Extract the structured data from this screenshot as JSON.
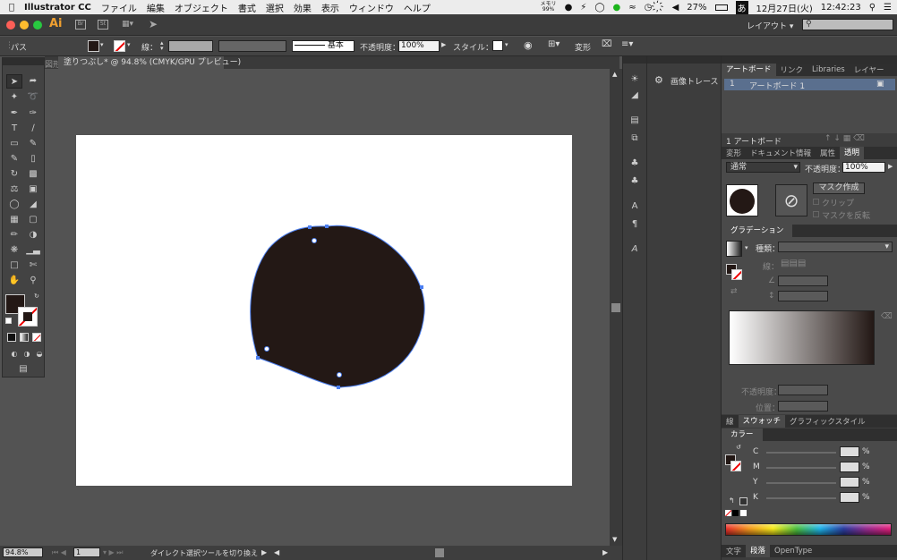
{
  "menubar": {
    "app": "Illustrator CC",
    "items": [
      "ファイル",
      "編集",
      "オブジェクト",
      "書式",
      "選択",
      "効果",
      "表示",
      "ウィンドウ",
      "ヘルプ"
    ],
    "memory_label": "メモリ",
    "memory_value": "99%",
    "battery": "27%",
    "date": "12月27日(火)",
    "time": "12:42:23"
  },
  "titlebar": {
    "ai_logo": "Ai",
    "workspace": "レイアウト",
    "search_placeholder": ""
  },
  "control": {
    "selection": "パス",
    "stroke_label": "線：",
    "stroke_style": "基本",
    "opacity_label": "不透明度：",
    "opacity_value": "100%",
    "style_label": "スタイル：",
    "transform_label": "変形"
  },
  "document": {
    "tab_prev": "図形",
    "tab_title": "塗りつぶし* @ 94.8% (CMYK/GPU プレビュー)"
  },
  "status": {
    "zoom": "94.8%",
    "page": "1",
    "tool_hint": "ダイレクト選択ツールを切り換え"
  },
  "dock": {
    "image_trace": "画像トレース"
  },
  "artboards_panel": {
    "tabs": [
      "アートボード",
      "リンク",
      "Libraries",
      "レイヤー"
    ],
    "row_index": "1",
    "row_name": "アートボード 1",
    "footer": "1 アートボード"
  },
  "transparency_panel": {
    "tabs": [
      "変形",
      "ドキュメント情報",
      "属性",
      "透明"
    ],
    "blend_mode": "通常",
    "opacity_label": "不透明度：",
    "opacity_value": "100%",
    "make_mask": "マスク作成",
    "clip": "クリップ",
    "invert_mask": "マスクを反転"
  },
  "gradient_panel": {
    "title": "グラデーション",
    "type_label": "種類：",
    "stroke_label": "線：",
    "opacity_label": "不透明度：",
    "position_label": "位置："
  },
  "swatch_tabs": [
    "線",
    "スウォッチ",
    "グラフィックスタイル"
  ],
  "color_panel": {
    "title": "カラー",
    "channels": [
      {
        "name": "C",
        "unit": "%"
      },
      {
        "name": "M",
        "unit": "%"
      },
      {
        "name": "Y",
        "unit": "%"
      },
      {
        "name": "K",
        "unit": "%"
      }
    ]
  },
  "char_tabs": [
    "文字",
    "段落",
    "OpenType"
  ],
  "colors": {
    "shape_fill": "#231815",
    "anchor": "#4c7ff0",
    "orange": "#f0a030"
  }
}
